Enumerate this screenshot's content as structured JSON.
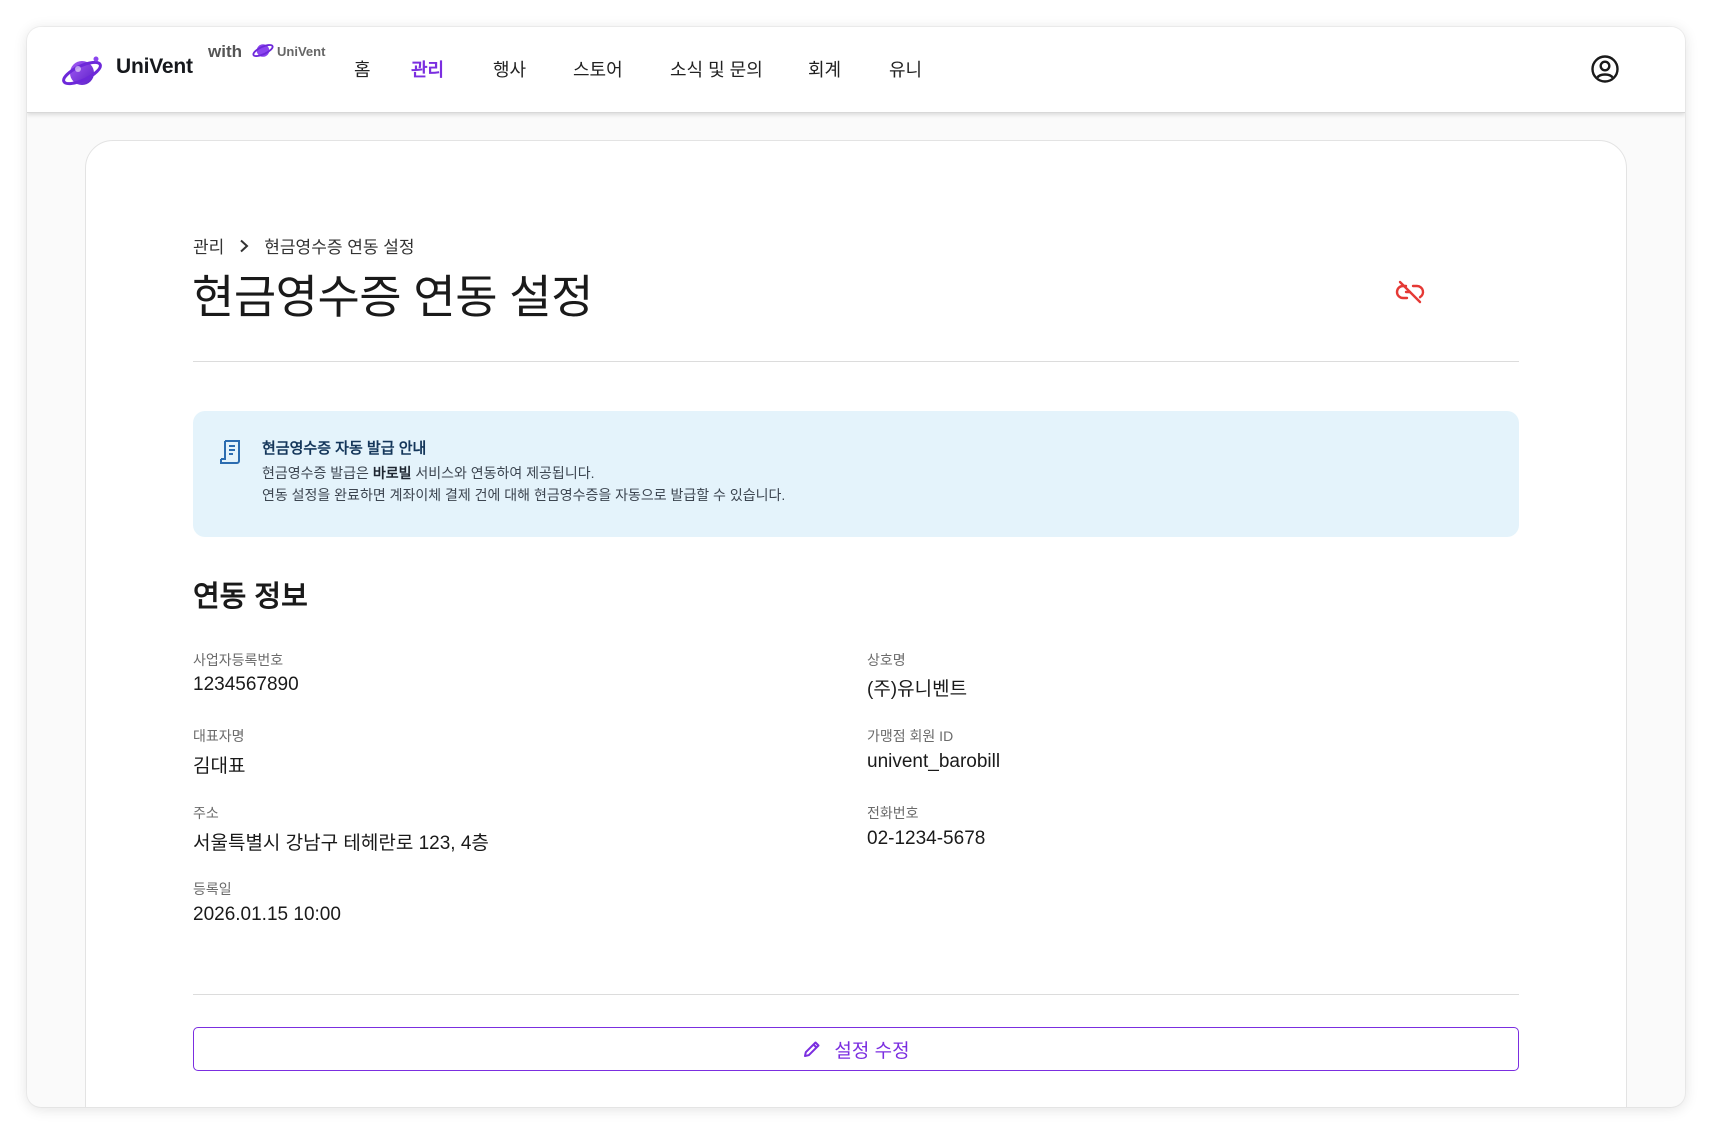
{
  "app": {
    "brand": "UniVent",
    "with_label": "with",
    "with_brand": "UniVent",
    "brand_color": "#7b2ee0"
  },
  "nav": {
    "items": [
      {
        "label": "홈",
        "active": false
      },
      {
        "label": "관리",
        "active": true
      },
      {
        "label": "행사",
        "active": false
      },
      {
        "label": "스토어",
        "active": false
      },
      {
        "label": "소식 및 문의",
        "active": false
      },
      {
        "label": "회계",
        "active": false
      },
      {
        "label": "유니",
        "active": false
      }
    ],
    "account_icon": "account-circle-icon"
  },
  "breadcrumb": {
    "root": "관리",
    "current": "현금영수증 연동 설정"
  },
  "page": {
    "title": "현금영수증 연동 설정",
    "unlink_icon": "link-off-icon",
    "unlink_color": "#e53935"
  },
  "notice": {
    "icon": "receipt-icon",
    "title": "현금영수증 자동 발급 안내",
    "line1_prefix": "현금영수증 발급은 ",
    "line1_bold": "바로빌",
    "line1_suffix": " 서비스와 연동하여 제공됩니다.",
    "line2": "연동 설정을 완료하면 계좌이체 결제 건에 대해 현금영수증을 자동으로 발급할 수 있습니다.",
    "background": "#e4f3fb"
  },
  "info": {
    "section_title": "연동 정보",
    "business_number": {
      "label": "사업자등록번호",
      "value": "1234567890"
    },
    "company_name": {
      "label": "상호명",
      "value": "(주)유니벤트"
    },
    "representative": {
      "label": "대표자명",
      "value": "김대표"
    },
    "member_id": {
      "label": "가맹점 회원 ID",
      "value": "univent_barobill"
    },
    "address": {
      "label": "주소",
      "value": "서울특별시 강남구 테헤란로 123, 4층"
    },
    "phone": {
      "label": "전화번호",
      "value": "02-1234-5678"
    },
    "registered_at": {
      "label": "등록일",
      "value": "2026.01.15 10:00"
    }
  },
  "actions": {
    "edit_label": "설정 수정",
    "edit_icon": "pencil-icon"
  }
}
